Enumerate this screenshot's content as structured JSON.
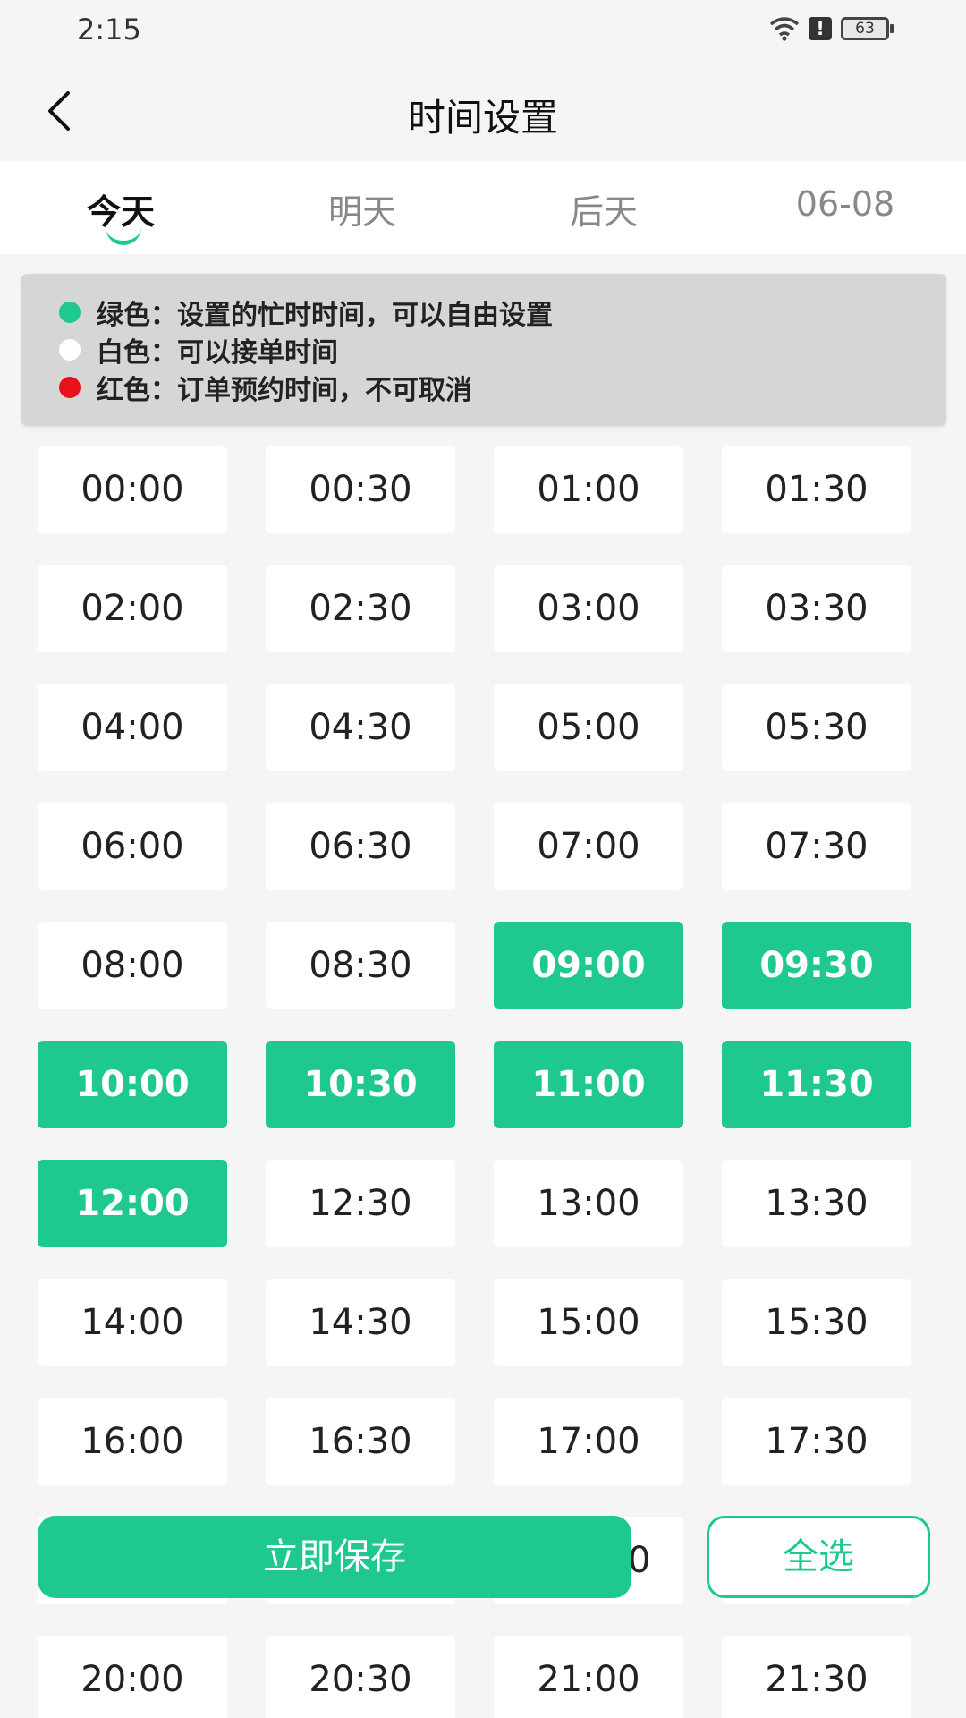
{
  "status_bar": {
    "time": "2:15",
    "battery": "63",
    "alert": "!"
  },
  "header": {
    "title": "时间设置"
  },
  "tabs": [
    {
      "label": "今天",
      "active": true
    },
    {
      "label": "明天",
      "active": false
    },
    {
      "label": "后天",
      "active": false
    },
    {
      "label": "06-08",
      "active": false
    }
  ],
  "legend": [
    {
      "color": "#1fc891",
      "text": "绿色：设置的忙时时间，可以自由设置"
    },
    {
      "color": "#ffffff",
      "text": "白色：可以接单时间"
    },
    {
      "color": "#e8101a",
      "text": "红色：订单预约时间，不可取消"
    }
  ],
  "slots": [
    {
      "time": "00:00",
      "state": "free"
    },
    {
      "time": "00:30",
      "state": "free"
    },
    {
      "time": "01:00",
      "state": "free"
    },
    {
      "time": "01:30",
      "state": "free"
    },
    {
      "time": "02:00",
      "state": "free"
    },
    {
      "time": "02:30",
      "state": "free"
    },
    {
      "time": "03:00",
      "state": "free"
    },
    {
      "time": "03:30",
      "state": "free"
    },
    {
      "time": "04:00",
      "state": "free"
    },
    {
      "time": "04:30",
      "state": "free"
    },
    {
      "time": "05:00",
      "state": "free"
    },
    {
      "time": "05:30",
      "state": "free"
    },
    {
      "time": "06:00",
      "state": "free"
    },
    {
      "time": "06:30",
      "state": "free"
    },
    {
      "time": "07:00",
      "state": "free"
    },
    {
      "time": "07:30",
      "state": "free"
    },
    {
      "time": "08:00",
      "state": "free"
    },
    {
      "time": "08:30",
      "state": "free"
    },
    {
      "time": "09:00",
      "state": "busy"
    },
    {
      "time": "09:30",
      "state": "busy"
    },
    {
      "time": "10:00",
      "state": "busy"
    },
    {
      "time": "10:30",
      "state": "busy"
    },
    {
      "time": "11:00",
      "state": "busy"
    },
    {
      "time": "11:30",
      "state": "busy"
    },
    {
      "time": "12:00",
      "state": "busy"
    },
    {
      "time": "12:30",
      "state": "free"
    },
    {
      "time": "13:00",
      "state": "free"
    },
    {
      "time": "13:30",
      "state": "free"
    },
    {
      "time": "14:00",
      "state": "free"
    },
    {
      "time": "14:30",
      "state": "free"
    },
    {
      "time": "15:00",
      "state": "free"
    },
    {
      "time": "15:30",
      "state": "free"
    },
    {
      "time": "16:00",
      "state": "free"
    },
    {
      "time": "16:30",
      "state": "free"
    },
    {
      "time": "17:00",
      "state": "free"
    },
    {
      "time": "17:30",
      "state": "free"
    },
    {
      "time": "",
      "state": "free"
    },
    {
      "time": "",
      "state": "free"
    },
    {
      "time": "0",
      "state": "free"
    },
    {
      "time": "",
      "state": "free"
    },
    {
      "time": "20:00",
      "state": "free"
    },
    {
      "time": "20:30",
      "state": "free"
    },
    {
      "time": "21:00",
      "state": "free"
    },
    {
      "time": "21:30",
      "state": "free"
    }
  ],
  "actions": {
    "save_label": "立即保存",
    "select_all_label": "全选"
  }
}
